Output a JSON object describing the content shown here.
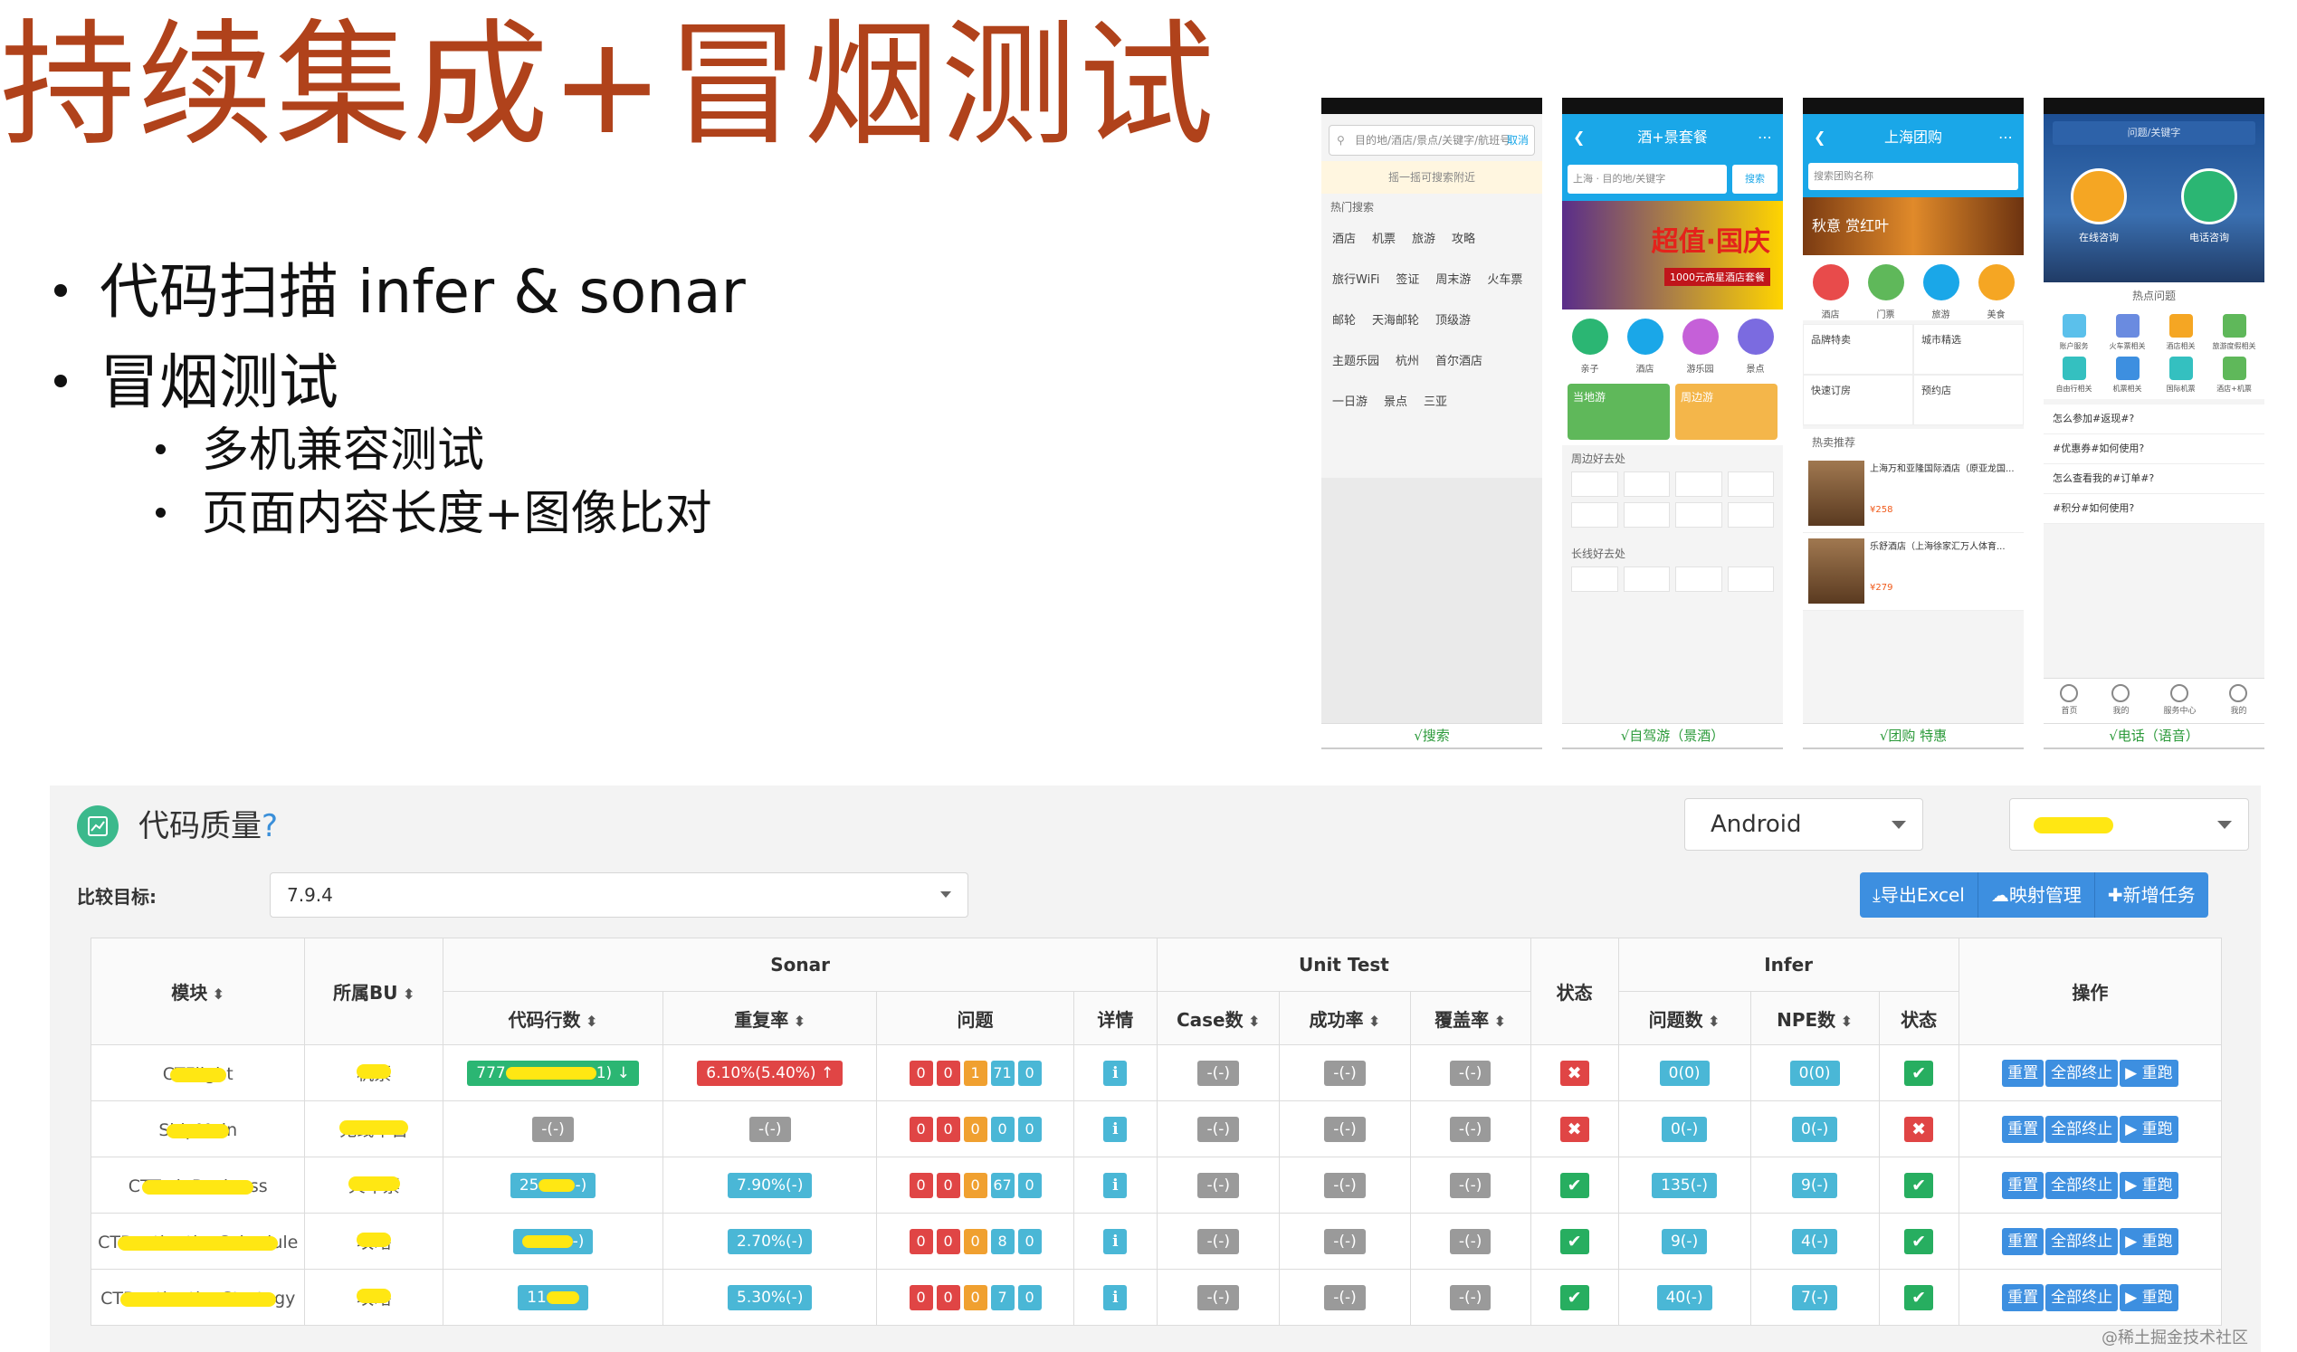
{
  "slide": {
    "title": "持续集成+冒烟测试",
    "bullets": [
      {
        "text": "代码扫描 infer & sonar",
        "level": 1
      },
      {
        "text": "冒烟测试",
        "level": 1
      },
      {
        "text": "多机兼容测试",
        "level": 2
      },
      {
        "text": "页面内容长度+图像比对",
        "level": 2
      }
    ]
  },
  "phones": [
    {
      "header_color": "#1aa7e8",
      "search_placeholder": "目的地/酒店/景点/关键字/航班号",
      "search_cancel": "取消",
      "voice_hint": "摇一摇可搜索附近",
      "section": "热门搜索",
      "chips": [
        "酒店",
        "机票",
        "旅游",
        "攻略",
        "旅行WiFi",
        "签证",
        "周末游",
        "火车票",
        "邮轮",
        "天海邮轮",
        "顶级游",
        "主题乐园",
        "杭州",
        "首尔酒店",
        "一日游",
        "景点",
        "三亚"
      ],
      "footer": "√搜索"
    },
    {
      "header_color": "#1aa7e8",
      "header": "酒+景套餐",
      "search_placeholder": "上海 · 目的地/关键字",
      "search_button": "搜索",
      "banner_title": "超值·国庆",
      "banner_sub": "1000元高星酒店套餐",
      "icons": [
        "亲子",
        "酒店",
        "游乐园",
        "景点"
      ],
      "cards": [
        "当地游",
        "周边游"
      ],
      "sections": [
        "周边好去处",
        "长线好去处"
      ],
      "footer": "√自驾游（景酒）"
    },
    {
      "header_color": "#1aa7e8",
      "header": "上海团购",
      "search_placeholder": "搜索团购名称",
      "banner_title": "秋意 赏红叶",
      "icons": [
        "酒店",
        "门票",
        "旅游",
        "美食"
      ],
      "rows": [
        "品牌特卖",
        "城市精选",
        "快速订房",
        "预约店"
      ],
      "section": "热卖推荐",
      "hotels": [
        {
          "name": "上海万和亚隆国际酒店（原亚龙国...",
          "price": "¥258"
        },
        {
          "name": "乐舒酒店（上海徐家汇万人体育...",
          "price": "¥279"
        }
      ],
      "footer": "√团购 特惠"
    },
    {
      "header_color": "#1e5fa8",
      "search_placeholder": "问题/关键字",
      "big_buttons": [
        {
          "label": "在线咨询",
          "color": "#f5a623"
        },
        {
          "label": "电话咨询",
          "color": "#2bb673"
        }
      ],
      "section": "热点问题",
      "grid": [
        "账户服务",
        "火车票相关",
        "酒店相关",
        "旅游度假相关",
        "自由行相关",
        "机票相关",
        "国际机票",
        "酒店+机票"
      ],
      "faqs": [
        "怎么参加#返现#?",
        "#优惠券#如何使用?",
        "怎么查看我的#订单#?",
        "#积分#如何使用?"
      ],
      "tabs": [
        "首页",
        "我的",
        "服务中心",
        "我的"
      ],
      "footer": "√电话（语音）"
    }
  ],
  "dashboard": {
    "title": "代码质量",
    "help": "?",
    "platform": "Android",
    "compare_label": "比较目标:",
    "compare_value": "7.9.4",
    "actions": [
      {
        "label": "导出Excel",
        "icon": "download-icon"
      },
      {
        "label": "映射管理",
        "icon": "cloud-icon"
      },
      {
        "label": "新增任务",
        "icon": "plus-icon"
      }
    ],
    "groups": {
      "sonar": "Sonar",
      "unit_test": "Unit Test",
      "infer": "Infer"
    },
    "headers": {
      "module": "模块",
      "bu": "所属BU",
      "lines": "代码行数",
      "dup": "重复率",
      "issues": "问题",
      "detail": "详情",
      "cases": "Case数",
      "success": "成功率",
      "coverage": "覆盖率",
      "status": "状态",
      "problems": "问题数",
      "npe": "NPE数",
      "infer_status": "状态",
      "ops": "操作"
    },
    "rows": [
      {
        "module": "CTFlight",
        "bu": "机票",
        "lines": "777",
        "lines_tail": "1) ↓",
        "lines_color": "green",
        "dup": "6.10%(5.40%) ↑",
        "dup_color": "red",
        "issues": [
          "0",
          "0",
          "1",
          "71",
          "0"
        ],
        "cases": "-(-)",
        "success": "-(-)",
        "coverage": "-(-)",
        "status": "fail",
        "problems": "0(0)",
        "npe": "0(0)",
        "infer_status": "ok"
      },
      {
        "module": "ShipMain",
        "bu": "无线平台",
        "lines": "-(-)",
        "lines_tail": "",
        "lines_color": "grey",
        "dup": "-(-)",
        "dup_color": "grey",
        "issues": [
          "0",
          "0",
          "0",
          "0",
          "0"
        ],
        "cases": "-(-)",
        "success": "-(-)",
        "coverage": "-(-)",
        "status": "fail",
        "problems": "0(-)",
        "npe": "0(-)",
        "infer_status": "fail"
      },
      {
        "module": "CTTrainBusiness",
        "bu": "火车票",
        "lines": "25",
        "lines_tail": "-)",
        "lines_color": "teal",
        "dup": "7.90%(-)",
        "dup_color": "teal",
        "issues": [
          "0",
          "0",
          "0",
          "67",
          "0"
        ],
        "cases": "-(-)",
        "success": "-(-)",
        "coverage": "-(-)",
        "status": "ok",
        "problems": "135(-)",
        "npe": "9(-)",
        "infer_status": "ok"
      },
      {
        "module": "CTDestinationSchedule",
        "bu": "攻略",
        "lines": "",
        "lines_tail": "-)",
        "lines_color": "teal",
        "dup": "2.70%(-)",
        "dup_color": "teal",
        "issues": [
          "0",
          "0",
          "0",
          "8",
          "0"
        ],
        "cases": "-(-)",
        "success": "-(-)",
        "coverage": "-(-)",
        "status": "ok",
        "problems": "9(-)",
        "npe": "4(-)",
        "infer_status": "ok"
      },
      {
        "module": "CTDestinationStrategy",
        "bu": "攻略",
        "lines": "11",
        "lines_tail": "",
        "lines_color": "teal",
        "dup": "5.30%(-)",
        "dup_color": "teal",
        "issues": [
          "0",
          "0",
          "0",
          "7",
          "0"
        ],
        "cases": "-(-)",
        "success": "-(-)",
        "coverage": "-(-)",
        "status": "ok",
        "problems": "40(-)",
        "npe": "7(-)",
        "infer_status": "ok"
      }
    ],
    "ops": [
      "重置",
      "全部终止",
      "▶ 重跑"
    ],
    "watermark": "@稀土掘金技术社区"
  }
}
